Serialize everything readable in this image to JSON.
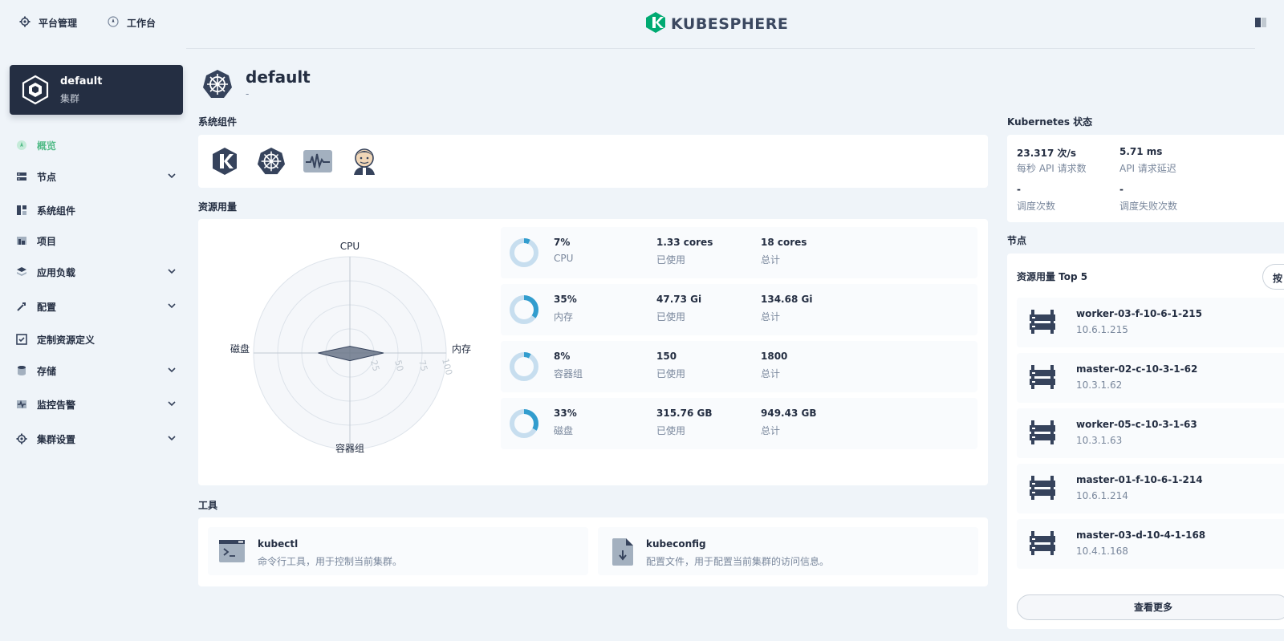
{
  "topbar": {
    "platform_label": "平台管理",
    "workbench_label": "工作台",
    "brand": "KUBESPHERE"
  },
  "cluster": {
    "name": "default",
    "type": "集群"
  },
  "sidebar": {
    "items": [
      {
        "label": "概览",
        "icon": "overview-icon"
      },
      {
        "label": "节点",
        "icon": "nodes-icon"
      },
      {
        "label": "系统组件",
        "icon": "components-icon"
      },
      {
        "label": "项目",
        "icon": "projects-icon"
      },
      {
        "label": "应用负载",
        "icon": "workloads-icon"
      },
      {
        "label": "配置",
        "icon": "config-icon"
      },
      {
        "label": "定制资源定义",
        "icon": "crd-icon"
      },
      {
        "label": "存储",
        "icon": "storage-icon"
      },
      {
        "label": "监控告警",
        "icon": "monitoring-icon"
      },
      {
        "label": "集群设置",
        "icon": "settings-icon"
      }
    ]
  },
  "page": {
    "title": "default",
    "subtitle": "-"
  },
  "sections": {
    "components": "系统组件",
    "resources": "资源用量",
    "tools": "工具",
    "k8s": "Kubernetes 状态",
    "nodes": "节点"
  },
  "radar": {
    "axes": {
      "top": "CPU",
      "right": "内存",
      "bottom": "容器组",
      "left": "磁盘"
    },
    "ticks": [
      "25",
      "50",
      "75",
      "100"
    ]
  },
  "usage": [
    {
      "percent": "7%",
      "name": "CPU",
      "used": "1.33 cores",
      "used_label": "已使用",
      "total": "18 cores",
      "total_label": "总计",
      "fraction": 0.07
    },
    {
      "percent": "35%",
      "name": "内存",
      "used": "47.73 Gi",
      "used_label": "已使用",
      "total": "134.68 Gi",
      "total_label": "总计",
      "fraction": 0.35
    },
    {
      "percent": "8%",
      "name": "容器组",
      "used": "150",
      "used_label": "已使用",
      "total": "1800",
      "total_label": "总计",
      "fraction": 0.08
    },
    {
      "percent": "33%",
      "name": "磁盘",
      "used": "315.76 GB",
      "used_label": "已使用",
      "total": "949.43 GB",
      "total_label": "总计",
      "fraction": 0.33
    }
  ],
  "tools": [
    {
      "name": "kubectl",
      "desc": "命令行工具，用于控制当前集群。",
      "icon": "terminal-icon"
    },
    {
      "name": "kubeconfig",
      "desc": "配置文件，用于配置当前集群的访问信息。",
      "icon": "file-download-icon"
    }
  ],
  "k8s_status": {
    "api_rate": "23.317 次/s",
    "api_rate_label": "每秒 API 请求数",
    "api_latency": "5.71 ms",
    "api_latency_label": "API 请求延迟",
    "schedule": "-",
    "schedule_label": "调度次数",
    "schedule_fail": "-",
    "schedule_fail_label": "调度失败次数"
  },
  "nodes": {
    "title": "资源用量 Top 5",
    "sort_label": "按 CPU",
    "more_label": "查看更多",
    "items": [
      {
        "name": "worker-03-f-10-6-1-215",
        "ip": "10.6.1.215"
      },
      {
        "name": "master-02-c-10-3-1-62",
        "ip": "10.3.1.62"
      },
      {
        "name": "worker-05-c-10-3-1-63",
        "ip": "10.3.1.63"
      },
      {
        "name": "master-01-f-10-6-1-214",
        "ip": "10.6.1.214"
      },
      {
        "name": "master-03-d-10-4-1-168",
        "ip": "10.4.1.168"
      }
    ]
  },
  "colors": {
    "accent": "#55bc8a",
    "dark": "#242e42",
    "ring": "#329dce",
    "ring_bg": "#c7deef"
  }
}
